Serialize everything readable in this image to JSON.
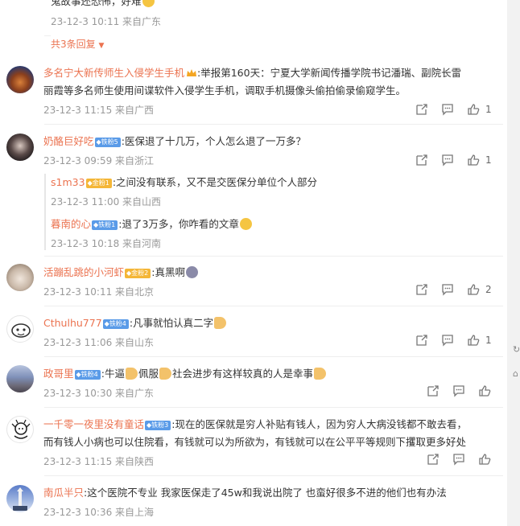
{
  "top_reply": {
    "text_partial": "鬼故事还恐怖，好难",
    "meta": "23-12-3 10:11 来自广东",
    "more_replies": "共3条回复"
  },
  "comments": [
    {
      "username": "多名宁大新传师生入侵学生手机",
      "text1": ":举报第160天：宁夏大学新闻传播学院书记潘瑞、副院长雷",
      "text2": "丽霞等多名师生使用间谍软件入侵学生手机，调取手机摄像头偷拍偷录偷窥学生。",
      "meta": "23-12-3 11:15 来自广西",
      "likes": "1"
    },
    {
      "username": "奶酪巨好吃",
      "badge": "铁粉5",
      "text": ":医保退了十几万，个人怎么退了一万多？",
      "meta": "23-12-3 09:59 来自浙江",
      "likes": "1",
      "replies": [
        {
          "username": "s1m33",
          "badge": "金粉1",
          "text": ":之间没有联系，又不是交医保分单位个人部分",
          "meta": "23-12-3 11:00 来自山西"
        },
        {
          "username": "暮南的心",
          "badge": "铁粉1",
          "text": ":退了3万多，你咋看的文章",
          "meta": "23-12-3 10:18 来自河南"
        }
      ]
    },
    {
      "username": "活蹦乱跳的小河虾",
      "badge": "金粉2",
      "text": ":真黑啊",
      "meta": "23-12-3 10:11 来自北京",
      "likes": "2"
    },
    {
      "username": "Cthulhu777",
      "badge": "铁粉4",
      "text": ":凡事就怕认真二字",
      "meta": "23-12-3 11:06 来自山东",
      "likes": "1"
    },
    {
      "username": "政哥里",
      "badge": "铁粉4",
      "text_a": ":牛逼",
      "text_b": "佩服",
      "text_c": "社会进步有这样较真的人是幸事",
      "meta": "23-12-3 10:30 来自广东",
      "likes": ""
    },
    {
      "username": "一千零一夜里没有童话",
      "badge": "铁粉3",
      "text1": ":现在的医保就是穷人补贴有钱人，因为穷人大病没钱都不敢去看，",
      "text2": "而有钱人小病也可以住院看，有钱就可以为所欲为，有钱就可以在公平平等规则下攫取更多好处",
      "meta": "23-12-3 11:15 来自陕西",
      "likes": ""
    },
    {
      "username": "南瓜半只",
      "text": ":这个医院不专业 我家医保走了45w和我说出院了 也蛮好很多不进的他们也有办法",
      "meta": "23-12-3 10:36 来自上海"
    }
  ],
  "colors": {
    "username": "#eb7350",
    "meta": "#999999",
    "badge_blue": "#5a9be8",
    "badge_gold": "#f4b637"
  },
  "icons": [
    "share-icon",
    "comment-icon",
    "like-icon",
    "crown-icon"
  ]
}
